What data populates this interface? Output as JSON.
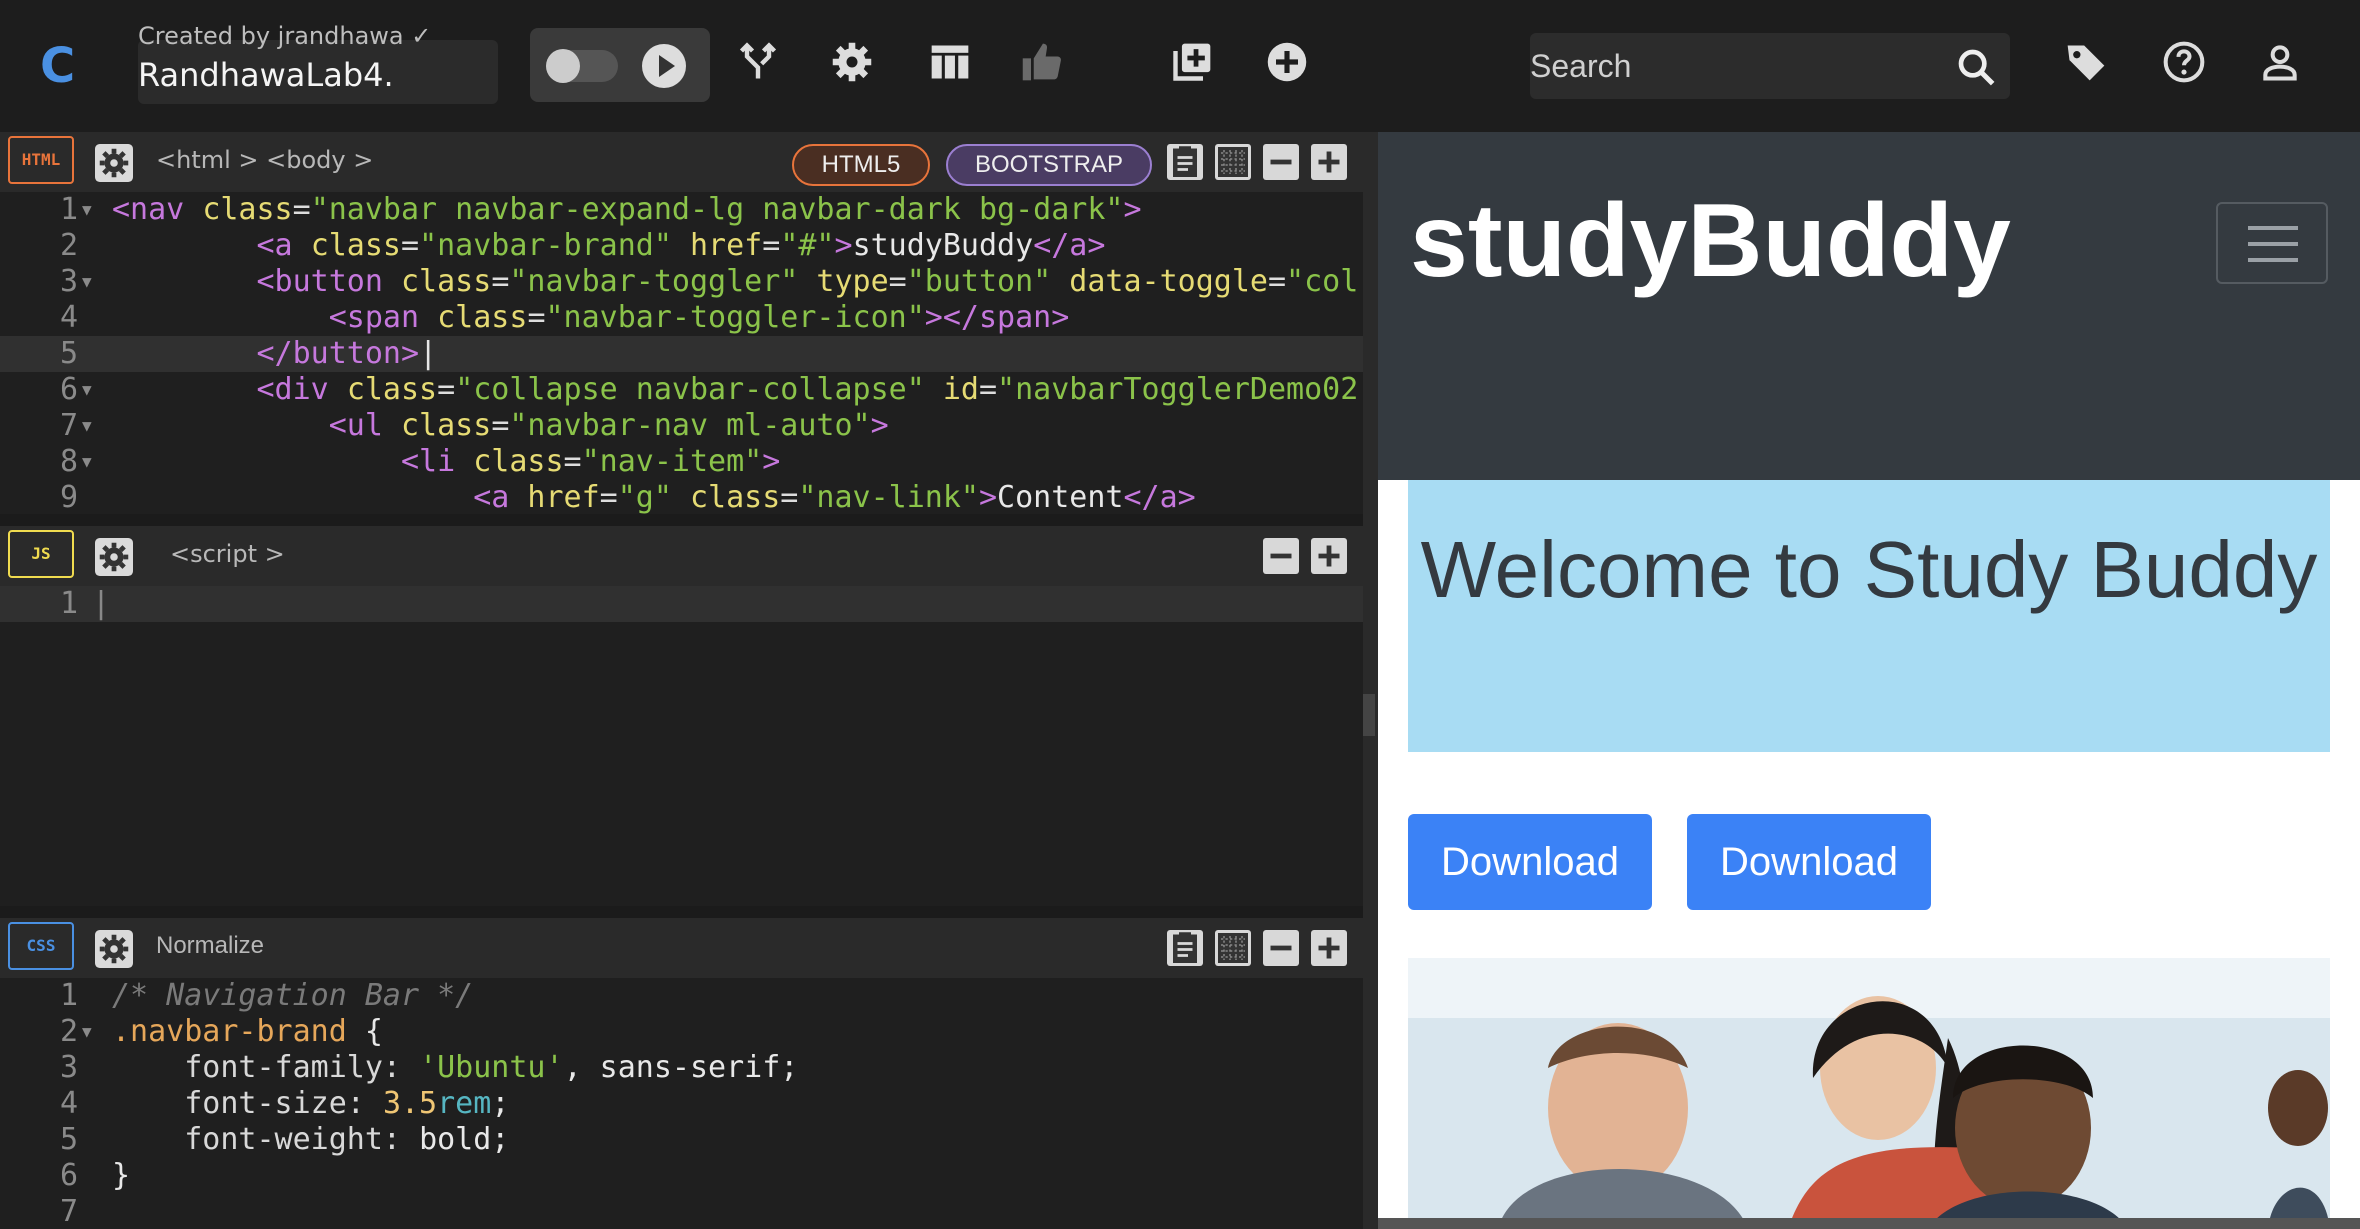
{
  "app": {
    "logo": "C",
    "created_by": "Created by jrandhawa ✓",
    "project_name": "RandhawaLab4."
  },
  "toolbar_icons": [
    "fork-icon",
    "settings-icon",
    "layout-icon",
    "like-icon",
    "new-pen-icon",
    "add-icon"
  ],
  "search": {
    "placeholder": "Search"
  },
  "html_pane": {
    "badge": "HTML",
    "breadcrumb": "<html > <body >",
    "pills": [
      "HTML5",
      "BOOTSTRAP"
    ]
  },
  "js_pane": {
    "badge": "JS",
    "breadcrumb": "<script >",
    "line_numbers": [
      "1"
    ]
  },
  "css_pane": {
    "badge": "CSS",
    "breadcrumb": "Normalize"
  },
  "preview": {
    "brand": "studyBuddy",
    "jumbotron_title": "Welcome to Study Buddy",
    "buttons": [
      "Download",
      "Download"
    ]
  },
  "colors": {
    "accent_blue": "#3b82f6",
    "jumbotron": "#a8dcf3",
    "navbar": "#343a40",
    "html_badge": "#e8743b",
    "js_badge": "#f0db4f",
    "css_badge": "#4a90e2"
  }
}
